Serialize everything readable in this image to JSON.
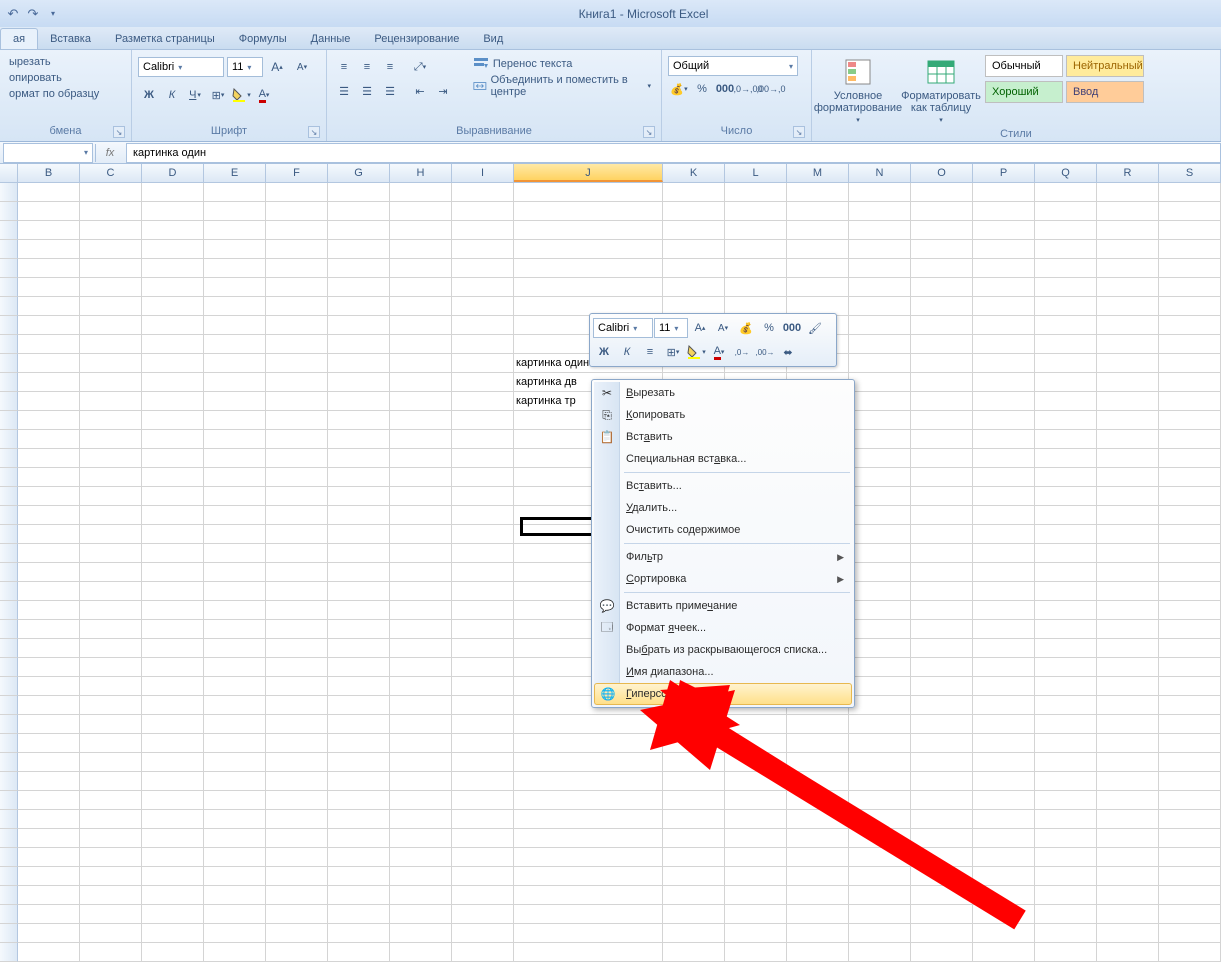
{
  "window": {
    "title": "Книга1 - Microsoft Excel"
  },
  "tabs": {
    "home": "ая",
    "insert": "Вставка",
    "layout": "Разметка страницы",
    "formulas": "Формулы",
    "data": "Данные",
    "review": "Рецензирование",
    "view": "Вид"
  },
  "clipboard": {
    "cut": "ырезать",
    "copy": "опировать",
    "format_painter": "ормат по образцу",
    "label": "бмена"
  },
  "font": {
    "name": "Calibri",
    "size": "11",
    "label": "Шрифт"
  },
  "alignment": {
    "wrap": "Перенос текста",
    "merge": "Объединить и поместить в центре",
    "label": "Выравнивание"
  },
  "number": {
    "format": "Общий",
    "label": "Число"
  },
  "styles": {
    "cond": "Условное форматирование",
    "table": "Форматировать как таблицу",
    "label": "Стили",
    "normal": "Обычный",
    "neutral": "Нейтральный",
    "good": "Хороший",
    "input": "Ввод"
  },
  "formula_bar": {
    "cell_ref": "",
    "value": "картинка один"
  },
  "columns": [
    "B",
    "C",
    "D",
    "E",
    "F",
    "G",
    "H",
    "I",
    "J",
    "K",
    "L",
    "M",
    "N",
    "O",
    "P",
    "Q",
    "R",
    "S"
  ],
  "col_widths": {
    "J": 149,
    "default": 62
  },
  "selected_column": "J",
  "cell_data": {
    "J1": "картинка один",
    "J2": "картинка дв",
    "J3": "картинка тр"
  },
  "mini_toolbar": {
    "font": "Calibri",
    "size": "11"
  },
  "context_menu": {
    "cut": "Вырезать",
    "copy": "Копировать",
    "paste": "Вставить",
    "paste_special": "Специальная вставка...",
    "insert": "Вставить...",
    "delete": "Удалить...",
    "clear": "Очистить содержимое",
    "filter": "Фильтр",
    "sort": "Сортировка",
    "comment": "Вставить примечание",
    "format_cells": "Формат ячеек...",
    "dropdown": "Выбрать из раскрывающегося списка...",
    "name_range": "Имя диапазона...",
    "hyperlink": "Гиперссылка..."
  }
}
